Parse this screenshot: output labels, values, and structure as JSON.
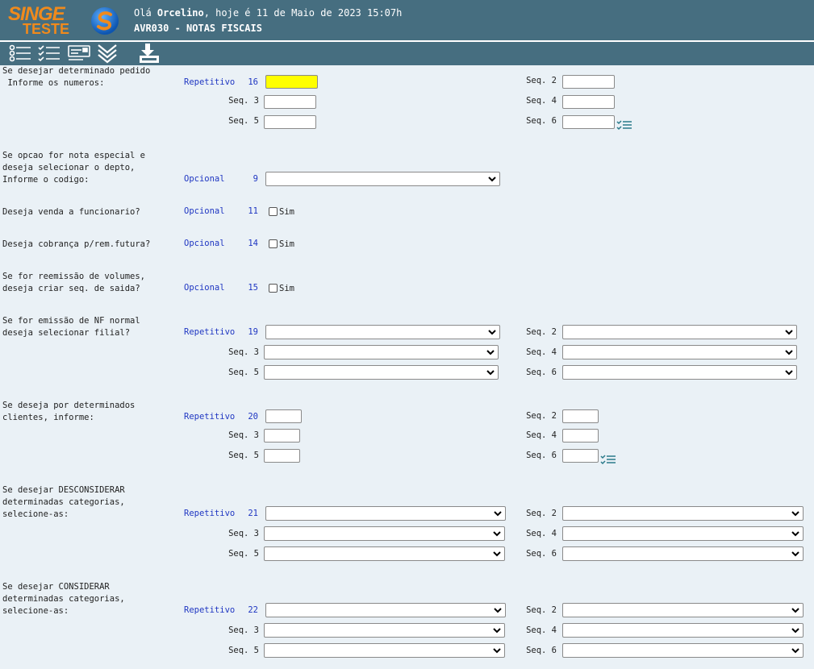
{
  "app": {
    "logo_top": "SINGE",
    "logo_bottom": "TESTE",
    "greeting_prefix": "Olá",
    "user": "Orcelino",
    "greeting_suffix": ", hoje é 11 de Maio de 2023 15:07h",
    "program": "AVR030 - NOTAS FISCAIS",
    "colors": {
      "header": "#466e80",
      "accent": "#f08a1c",
      "label_blue": "#1f36c2",
      "highlight": "#ffff00"
    }
  },
  "toolbar": {
    "icons": [
      "list-icon",
      "checklist-icon",
      "card-icon",
      "double-chevron-down-icon",
      "download-icon"
    ]
  },
  "labels": {
    "seq2": "Seq. 2",
    "seq3": "Seq. 3",
    "seq4": "Seq. 4",
    "seq5": "Seq. 5",
    "seq6": "Seq. 6",
    "sim": "Sim"
  },
  "q16": {
    "line1": "Se desejar determinado pedido",
    "line2": " Informe os numeros:",
    "mode": "Repetitivo",
    "num": "16"
  },
  "q9": {
    "line1": "Se opcao for nota especial e",
    "line2": "deseja selecionar o depto,",
    "line3": "Informe o codigo:",
    "mode": "Opcional",
    "num": "9"
  },
  "q11": {
    "line1": "Deseja venda a funcionario?",
    "mode": "Opcional",
    "num": "11"
  },
  "q14": {
    "line1": "Deseja cobrança p/rem.futura?",
    "mode": "Opcional",
    "num": "14"
  },
  "q15": {
    "line1": "Se for reemissão de volumes,",
    "line2": "deseja criar seq. de saida?",
    "mode": "Opcional",
    "num": "15"
  },
  "q19": {
    "line1": "Se for emissão de NF normal",
    "line2": "deseja selecionar filial?",
    "mode": "Repetitivo",
    "num": "19"
  },
  "q20": {
    "line1": "Se deseja por determinados",
    "line2": "clientes, informe:",
    "mode": "Repetitivo",
    "num": "20"
  },
  "q21": {
    "line1": "Se desejar DESCONSIDERAR",
    "line2": "determinadas categorias,",
    "line3": "selecione-as:",
    "mode": "Repetitivo",
    "num": "21"
  },
  "q22": {
    "line1": "Se desejar CONSIDERAR",
    "line2": "determinadas categorias,",
    "line3": "selecione-as:",
    "mode": "Repetitivo",
    "num": "22"
  }
}
